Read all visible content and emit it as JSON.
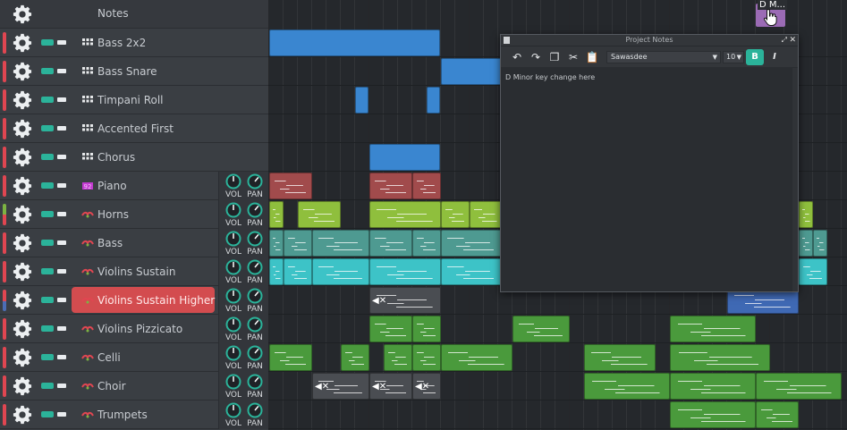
{
  "notes_track": {
    "label": "Notes"
  },
  "tracks": [
    {
      "name": "Bass 2x2",
      "icon": "pattern-grid-icon",
      "knobs": false
    },
    {
      "name": "Bass Snare",
      "icon": "pattern-grid-icon",
      "knobs": false
    },
    {
      "name": "Timpani Roll",
      "icon": "pattern-grid-icon",
      "knobs": false
    },
    {
      "name": "Accented First",
      "icon": "pattern-grid-icon",
      "knobs": false
    },
    {
      "name": "Chorus",
      "icon": "pattern-grid-icon",
      "knobs": false
    },
    {
      "name": "Piano",
      "icon": "piano-keys-icon",
      "knobs": true
    },
    {
      "name": "Horns",
      "icon": "instrument-icon",
      "knobs": true
    },
    {
      "name": "Bass",
      "icon": "instrument-icon",
      "knobs": true
    },
    {
      "name": "Violins Sustain",
      "icon": "instrument-icon",
      "knobs": true
    },
    {
      "name": "Violins Sustain Higher",
      "icon": "instrument-icon",
      "knobs": true,
      "selected": true
    },
    {
      "name": "Violins Pizzicato",
      "icon": "instrument-icon",
      "knobs": true
    },
    {
      "name": "Celli",
      "icon": "instrument-icon",
      "knobs": true
    },
    {
      "name": "Choir",
      "icon": "instrument-icon",
      "knobs": true
    },
    {
      "name": "Trumpets",
      "icon": "instrument-icon",
      "knobs": true
    }
  ],
  "knob_labels": {
    "vol": "VOL",
    "pan": "PAN"
  },
  "note_clip": {
    "label": "D M..."
  },
  "notes_window": {
    "title": "Project Notes",
    "font": "Sawasdee",
    "size": "10",
    "bold_label": "B",
    "italic_label": "I",
    "body": "D Minor key change here"
  },
  "colors": {
    "accent": "#2bb39a",
    "track_strip": "#e04651",
    "selected_track": "#d34c4f",
    "clip_blue": "#3a86d0",
    "clip_red": "#a14b4c",
    "clip_lime": "#8fbf3d",
    "clip_teal": "#4e9a91",
    "clip_cyan": "#3dc3c7",
    "clip_green": "#4a9a3c",
    "clip_dark": "#4a4d52",
    "clip_navy": "#3f69b4",
    "clip_purple": "#9b6bb5"
  }
}
